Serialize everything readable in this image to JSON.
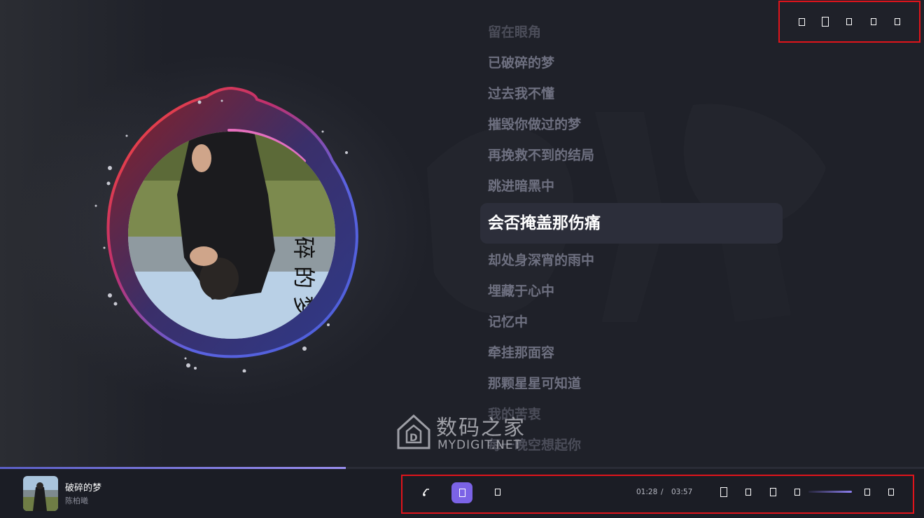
{
  "lyrics": {
    "lines": [
      {
        "text": "留在眼角"
      },
      {
        "text": "已破碎的梦"
      },
      {
        "text": "过去我不懂"
      },
      {
        "text": "摧毁你做过的梦"
      },
      {
        "text": "再挽救不到的结局"
      },
      {
        "text": "跳进暗黑中"
      },
      {
        "text": "会否掩盖那伤痛"
      },
      {
        "text": "却处身深宵的雨中"
      },
      {
        "text": "埋藏于心中"
      },
      {
        "text": "记忆中"
      },
      {
        "text": "牵挂那面容"
      },
      {
        "text": "那颗星星可知道"
      },
      {
        "text": "我的苦衷"
      },
      {
        "text": "每一晚空想起你"
      }
    ],
    "active_index": 6
  },
  "window_controls": [
    {
      "icon": "mini-player-icon"
    },
    {
      "icon": "fullscreen-icon"
    },
    {
      "icon": "minimize-icon"
    },
    {
      "icon": "maximize-icon"
    },
    {
      "icon": "close-icon"
    }
  ],
  "watermark": {
    "title": "数码之家",
    "subtitle": "MYDIGIT.NET"
  },
  "now_playing": {
    "title": "破碎的梦",
    "artist": "陈柏曦",
    "progress": 0.374
  },
  "player": {
    "current_time": "01:28",
    "separator": "/",
    "duration": "03:57",
    "volume": 1.0,
    "icons": {
      "left": [
        "lyrics-icon",
        "play-icon",
        "next-icon"
      ],
      "right": [
        "favorite-icon",
        "loop-icon",
        "playlist-icon",
        "volume-icon",
        "settings-icon",
        "more-icon"
      ]
    },
    "accent": "#7b63e6"
  },
  "colors": {
    "background": "#1e2029",
    "highlight_box": "#e0141b",
    "ring_red": "#e0402a",
    "ring_blue": "#5a6ee6"
  }
}
